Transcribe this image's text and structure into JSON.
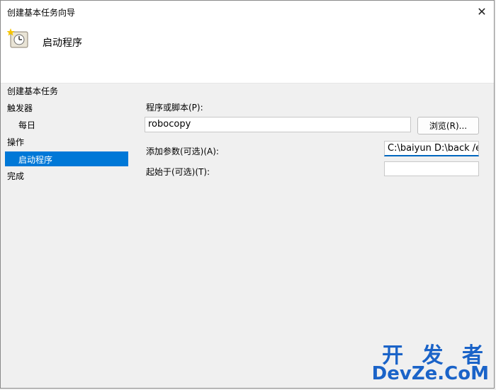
{
  "window": {
    "title": "创建基本任务向导",
    "close_glyph": "✕"
  },
  "header": {
    "title": "启动程序",
    "icon": "task-wizard-icon"
  },
  "steps": [
    {
      "label": "创建基本任务"
    },
    {
      "label": "触发器"
    },
    {
      "label": "每日"
    },
    {
      "label": "操作"
    },
    {
      "label": "启动程序"
    },
    {
      "label": "完成"
    }
  ],
  "form": {
    "program_label": "程序或脚本(P):",
    "program_value": "robocopy",
    "browse_label": "浏览(R)...",
    "args_label": "添加参数(可选)(A):",
    "args_value": "C:\\baiyun D:\\back /e",
    "start_label": "起始于(可选)(T):",
    "start_value": ""
  },
  "watermark": {
    "top": "开 发 者",
    "bottom": "DevZe.CoM"
  },
  "colors": {
    "accent": "#0078d7",
    "watermark": "#1a63c8"
  }
}
